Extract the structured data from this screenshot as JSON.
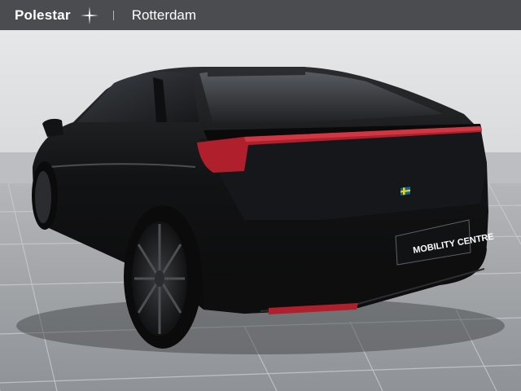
{
  "banner": {
    "brand": "Polestar",
    "logo_icon": "polestar-star-icon",
    "location": "Rotterdam"
  },
  "photo": {
    "plate_text": "MOBILITY CENTRE",
    "plate_flag_icon": "swedish-flag-icon"
  },
  "colors": {
    "banner_bg": "#4a4c4f",
    "car_body": "#121314",
    "taillight": "#b0202c",
    "floor": "#9b9ea2"
  }
}
